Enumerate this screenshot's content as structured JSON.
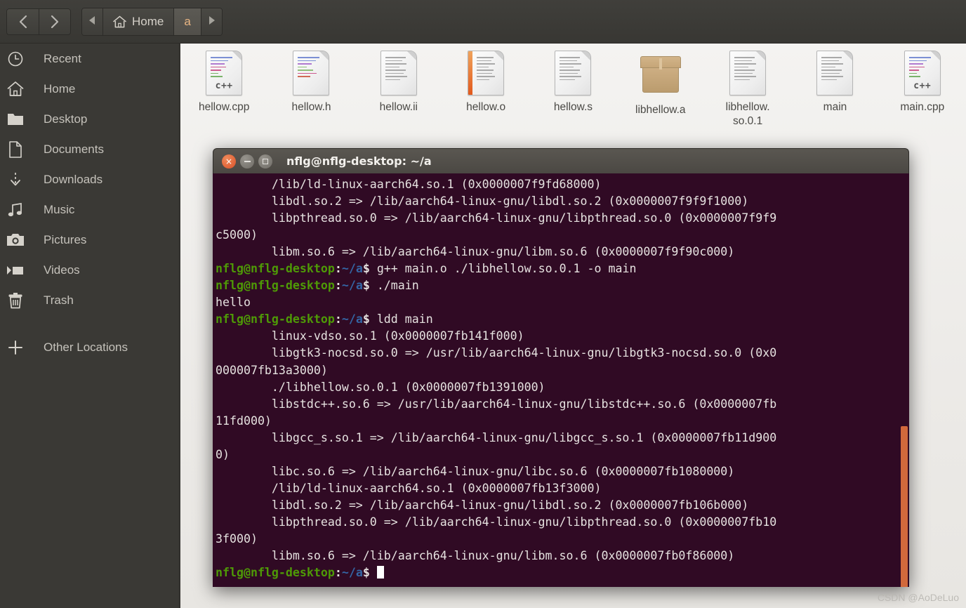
{
  "window": {
    "file_manager_title": "Home"
  },
  "nav": {
    "back_icon": "chevron-left-icon",
    "forward_icon": "chevron-right-icon",
    "prev_crumb_icon": "triangle-left-icon",
    "next_crumb_icon": "triangle-right-icon",
    "home_icon": "home-icon",
    "breadcrumbs": [
      {
        "label": "Home",
        "active": false
      },
      {
        "label": "a",
        "active": true
      }
    ]
  },
  "sidebar": {
    "items": [
      {
        "label": "Recent",
        "icon": "clock-icon"
      },
      {
        "label": "Home",
        "icon": "home-icon"
      },
      {
        "label": "Desktop",
        "icon": "folder-icon"
      },
      {
        "label": "Documents",
        "icon": "document-icon"
      },
      {
        "label": "Downloads",
        "icon": "download-icon"
      },
      {
        "label": "Music",
        "icon": "music-note-icon"
      },
      {
        "label": "Pictures",
        "icon": "camera-icon"
      },
      {
        "label": "Videos",
        "icon": "video-icon"
      },
      {
        "label": "Trash",
        "icon": "trash-icon"
      }
    ],
    "other_locations": {
      "label": "Other Locations",
      "icon": "plus-icon"
    }
  },
  "files": [
    {
      "name": "hellow.cpp",
      "icon": "cpp-file-icon"
    },
    {
      "name": "hellow.h",
      "icon": "header-file-icon"
    },
    {
      "name": "hellow.ii",
      "icon": "text-file-icon"
    },
    {
      "name": "hellow.o",
      "icon": "object-file-icon"
    },
    {
      "name": "hellow.s",
      "icon": "text-file-icon"
    },
    {
      "name": "libhellow.a",
      "icon": "archive-file-icon"
    },
    {
      "name": "libhellow.\nso.0.1",
      "icon": "text-file-icon"
    },
    {
      "name": "main",
      "icon": "text-file-icon"
    },
    {
      "name": "main.cpp",
      "icon": "cpp-file-icon"
    }
  ],
  "terminal": {
    "title": "nflg@nflg-desktop: ~/a",
    "close_label": "×",
    "prompt_user": "nflg@nflg-desktop",
    "prompt_colon": ":",
    "prompt_path": "~/a",
    "prompt_dollar": "$",
    "lines": [
      "        /lib/ld-linux-aarch64.so.1 (0x0000007f9fd68000)",
      "        libdl.so.2 => /lib/aarch64-linux-gnu/libdl.so.2 (0x0000007f9f9f1000)",
      "        libpthread.so.0 => /lib/aarch64-linux-gnu/libpthread.so.0 (0x0000007f9f9",
      "c5000)",
      "        libm.so.6 => /lib/aarch64-linux-gnu/libm.so.6 (0x0000007f9f90c000)",
      "PROMPT g++ main.o ./libhellow.so.0.1 -o main",
      "PROMPT ./main",
      "hello",
      "PROMPT ldd main",
      "        linux-vdso.so.1 (0x0000007fb141f000)",
      "        libgtk3-nocsd.so.0 => /usr/lib/aarch64-linux-gnu/libgtk3-nocsd.so.0 (0x0",
      "000007fb13a3000)",
      "        ./libhellow.so.0.1 (0x0000007fb1391000)",
      "        libstdc++.so.6 => /usr/lib/aarch64-linux-gnu/libstdc++.so.6 (0x0000007fb",
      "11fd000)",
      "        libgcc_s.so.1 => /lib/aarch64-linux-gnu/libgcc_s.so.1 (0x0000007fb11d900",
      "0)",
      "        libc.so.6 => /lib/aarch64-linux-gnu/libc.so.6 (0x0000007fb1080000)",
      "        /lib/ld-linux-aarch64.so.1 (0x0000007fb13f3000)",
      "        libdl.so.2 => /lib/aarch64-linux-gnu/libdl.so.2 (0x0000007fb106b000)",
      "        libpthread.so.0 => /lib/aarch64-linux-gnu/libpthread.so.0 (0x0000007fb10",
      "3f000)",
      "        libm.so.6 => /lib/aarch64-linux-gnu/libm.so.6 (0x0000007fb0f86000)",
      "PROMPT CURSOR"
    ]
  },
  "watermark": "CSDN @AoDeLuo",
  "colors": {
    "terminal_bg": "#300a24",
    "prompt_green": "#4e9a06",
    "prompt_blue": "#3465a4",
    "accent_orange": "#d2693c",
    "chrome_dark": "#3a3935",
    "file_area_bg": "#efedea"
  }
}
